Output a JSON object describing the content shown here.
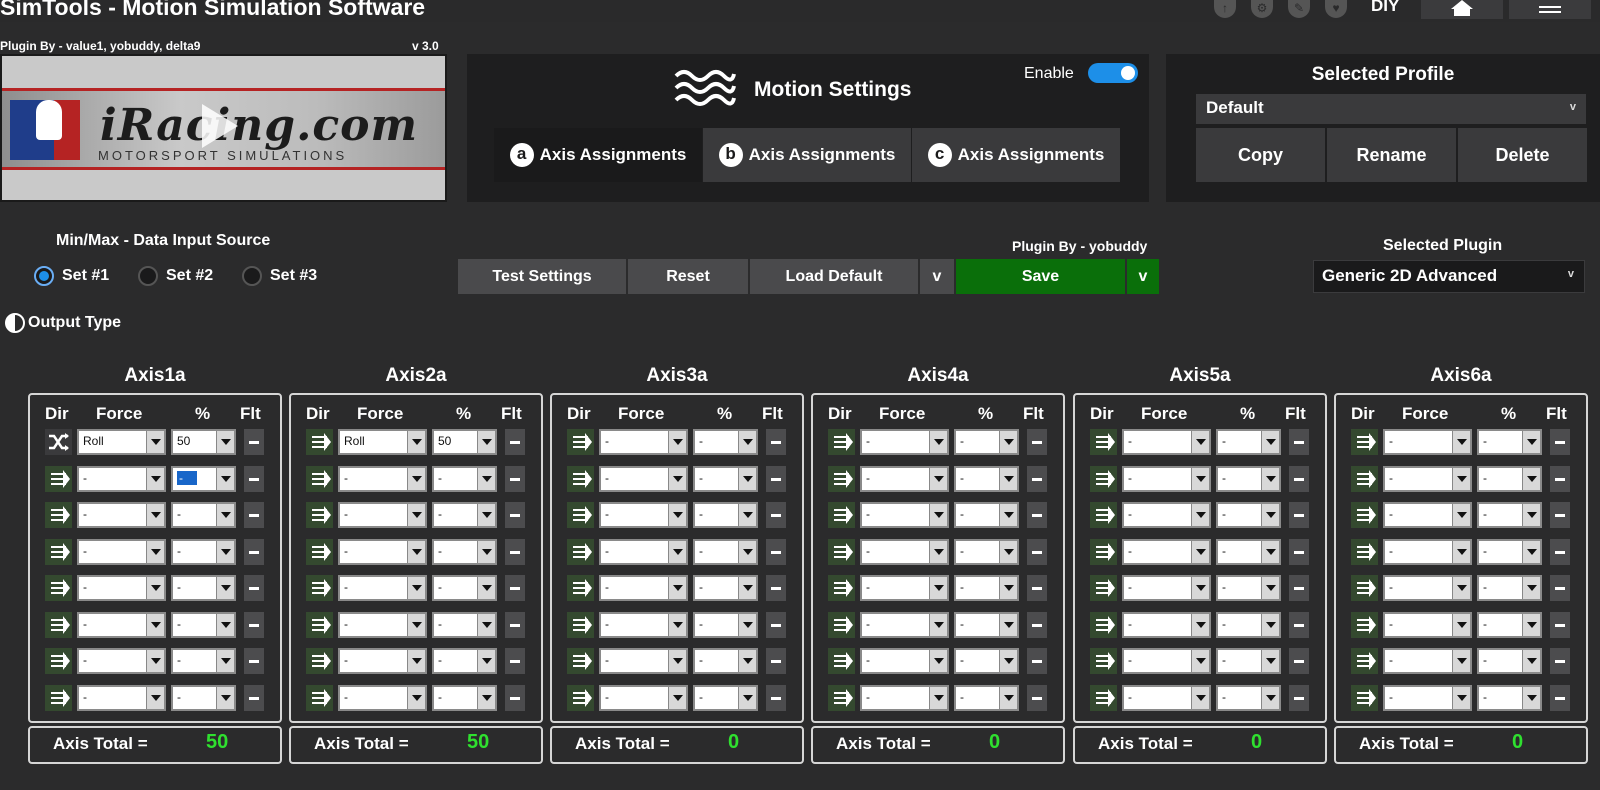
{
  "app": {
    "title": "SimTools - Motion Simulation Software",
    "diy": "DIY"
  },
  "plugin": {
    "credit": "Plugin By - value1, yobuddy, delta9",
    "version": "v 3.0",
    "banner_brand": "iRacing.com",
    "banner_sub": "MOTORSPORT SIMULATIONS"
  },
  "motion": {
    "title": "Motion Settings",
    "enable_label": "Enable",
    "enabled": true,
    "tabs": [
      {
        "badge": "a",
        "label": "Axis Assignments"
      },
      {
        "badge": "b",
        "label": "Axis Assignments"
      },
      {
        "badge": "c",
        "label": "Axis Assignments"
      }
    ]
  },
  "profile": {
    "title": "Selected Profile",
    "value": "Default",
    "chevron": "v",
    "buttons": [
      "Copy",
      "Rename",
      "Delete"
    ]
  },
  "source": {
    "label": "Min/Max - Data Input Source",
    "sets": [
      "Set #1",
      "Set #2",
      "Set #3"
    ],
    "selected": 0
  },
  "actions": {
    "test": "Test Settings",
    "reset": "Reset",
    "load_default": "Load Default",
    "chevron": "v",
    "save": "Save",
    "plugin_by": "Plugin By - yobuddy"
  },
  "selected_plugin": {
    "label": "Selected Plugin",
    "value": "Generic 2D Advanced",
    "chevron": "v"
  },
  "output_type": "Output Type",
  "headers": {
    "dir": "Dir",
    "force": "Force",
    "pct": "%",
    "flt": "Flt"
  },
  "total_label": "Axis Total =",
  "axes": [
    {
      "name": "Axis1a",
      "total": "50",
      "rows": [
        [
          "Roll",
          "50"
        ],
        [
          "-",
          "-"
        ],
        [
          "-",
          "-"
        ],
        [
          "-",
          "-"
        ],
        [
          "-",
          "-"
        ],
        [
          "-",
          "-"
        ],
        [
          "-",
          "-"
        ],
        [
          "-",
          "-"
        ]
      ]
    },
    {
      "name": "Axis2a",
      "total": "50",
      "rows": [
        [
          "Roll",
          "50"
        ],
        [
          "-",
          "-"
        ],
        [
          "-",
          "-"
        ],
        [
          "-",
          "-"
        ],
        [
          "-",
          "-"
        ],
        [
          "-",
          "-"
        ],
        [
          "-",
          "-"
        ],
        [
          "-",
          "-"
        ]
      ]
    },
    {
      "name": "Axis3a",
      "total": "0",
      "rows": [
        [
          "-",
          "-"
        ],
        [
          "-",
          "-"
        ],
        [
          "-",
          "-"
        ],
        [
          "-",
          "-"
        ],
        [
          "-",
          "-"
        ],
        [
          "-",
          "-"
        ],
        [
          "-",
          "-"
        ],
        [
          "-",
          "-"
        ]
      ]
    },
    {
      "name": "Axis4a",
      "total": "0",
      "rows": [
        [
          "-",
          "-"
        ],
        [
          "-",
          "-"
        ],
        [
          "-",
          "-"
        ],
        [
          "-",
          "-"
        ],
        [
          "-",
          "-"
        ],
        [
          "-",
          "-"
        ],
        [
          "-",
          "-"
        ],
        [
          "-",
          "-"
        ]
      ]
    },
    {
      "name": "Axis5a",
      "total": "0",
      "rows": [
        [
          "-",
          "-"
        ],
        [
          "-",
          "-"
        ],
        [
          "-",
          "-"
        ],
        [
          "-",
          "-"
        ],
        [
          "-",
          "-"
        ],
        [
          "-",
          "-"
        ],
        [
          "-",
          "-"
        ],
        [
          "-",
          "-"
        ]
      ]
    },
    {
      "name": "Axis6a",
      "total": "0",
      "rows": [
        [
          "-",
          "-"
        ],
        [
          "-",
          "-"
        ],
        [
          "-",
          "-"
        ],
        [
          "-",
          "-"
        ],
        [
          "-",
          "-"
        ],
        [
          "-",
          "-"
        ],
        [
          "-",
          "-"
        ],
        [
          "-",
          "-"
        ]
      ]
    }
  ],
  "colors": {
    "accent": "#1d8fe8",
    "save": "#0a6f0a",
    "total_value": "#2fe02f"
  }
}
